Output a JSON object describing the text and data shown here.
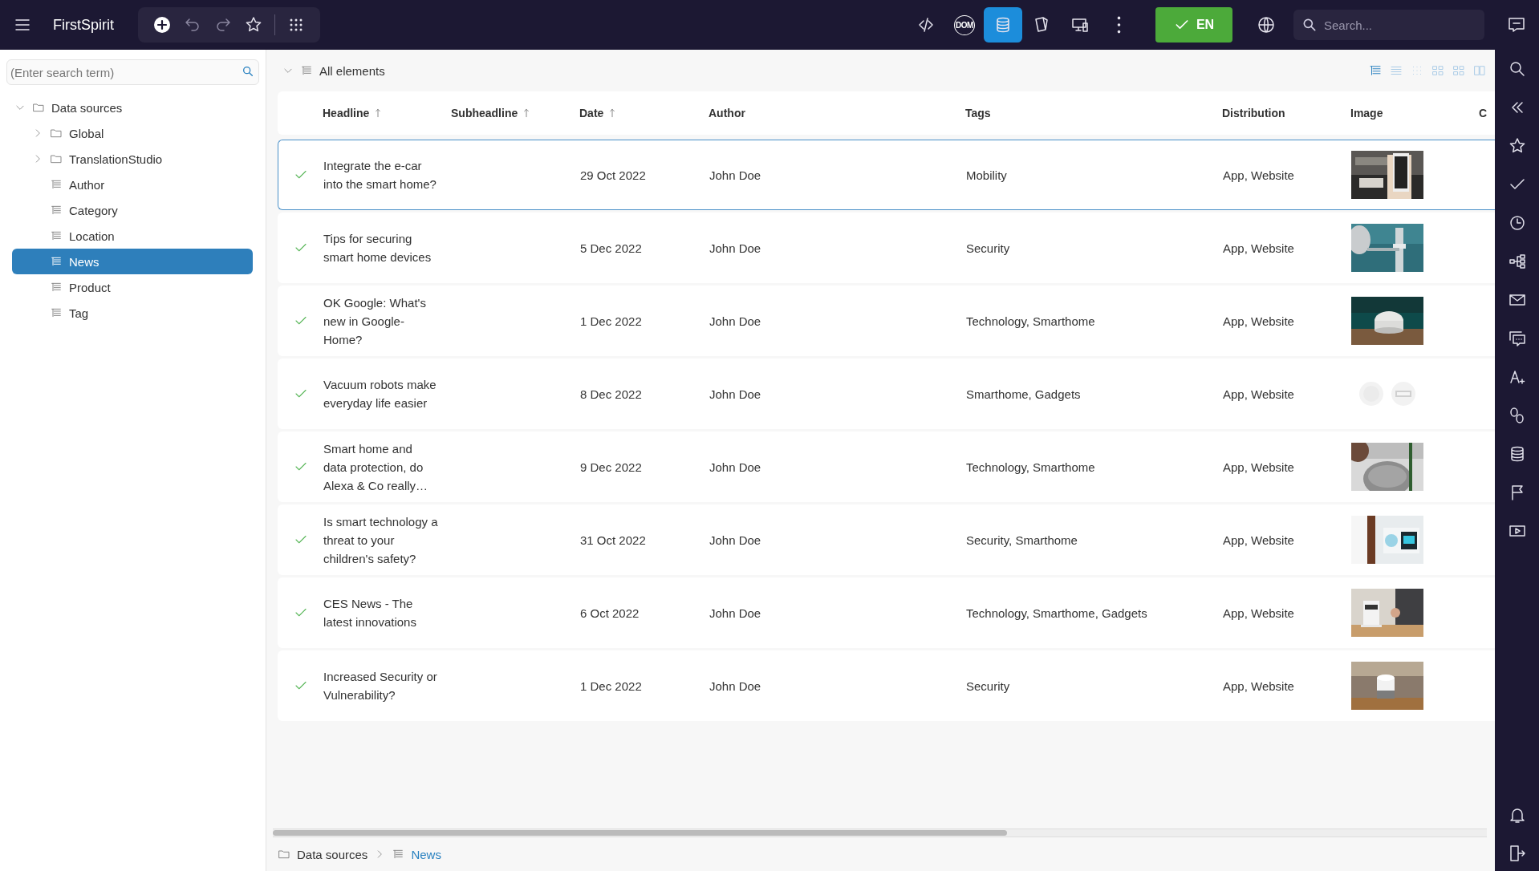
{
  "app": {
    "title": "FirstSpirit"
  },
  "toolbar_right": [
    {
      "kind": "code",
      "selected": false
    },
    {
      "kind": "dom",
      "label": "DOM",
      "selected": false
    },
    {
      "kind": "database",
      "selected": true
    },
    {
      "kind": "pages",
      "selected": false
    },
    {
      "kind": "devices",
      "selected": false
    },
    {
      "kind": "more",
      "selected": false
    }
  ],
  "language_button": {
    "label": "EN"
  },
  "search": {
    "placeholder": "Search..."
  },
  "tree_search": {
    "placeholder": "(Enter search term)"
  },
  "tree": [
    {
      "label": "Data sources",
      "kind": "folder",
      "expanded": true,
      "selected": false,
      "children": [
        {
          "label": "Global",
          "kind": "folder",
          "expanded": false,
          "selected": false
        },
        {
          "label": "TranslationStudio",
          "kind": "folder",
          "expanded": false,
          "selected": false
        },
        {
          "label": "Author",
          "kind": "table",
          "selected": false
        },
        {
          "label": "Category",
          "kind": "table",
          "selected": false
        },
        {
          "label": "Location",
          "kind": "table",
          "selected": false
        },
        {
          "label": "News",
          "kind": "table",
          "selected": true
        },
        {
          "label": "Product",
          "kind": "table",
          "selected": false
        },
        {
          "label": "Tag",
          "kind": "table",
          "selected": false
        }
      ]
    }
  ],
  "list_header": {
    "label": "All elements",
    "expanded": true
  },
  "view_modes": [
    {
      "selected": true
    },
    {
      "selected": false
    },
    {
      "selected": false
    },
    {
      "selected": false
    },
    {
      "selected": false
    },
    {
      "selected": false
    }
  ],
  "table": {
    "columns": [
      {
        "label": "Headline",
        "sorted": true
      },
      {
        "label": "Subheadline",
        "sorted": true
      },
      {
        "label": "Date",
        "sorted": true
      },
      {
        "label": "Author",
        "sorted": false
      },
      {
        "label": "Tags",
        "sorted": false
      },
      {
        "label": "Distribution",
        "sorted": false
      },
      {
        "label": "Image",
        "sorted": false
      },
      {
        "label": "C",
        "sorted": false
      }
    ],
    "rows": [
      {
        "released": true,
        "selected": true,
        "headline": "Integrate the e-car into the smart home?",
        "date": "29 Oct 2022",
        "author": "John Doe",
        "tags": "Mobility",
        "distribution": "App, Website"
      },
      {
        "released": true,
        "selected": false,
        "headline": "Tips for securing smart home devices",
        "date": "5 Dec 2022",
        "author": "John Doe",
        "tags": "Security",
        "distribution": "App, Website"
      },
      {
        "released": true,
        "selected": false,
        "headline": "OK Google: What's new in Google-Home?",
        "date": "1 Dec 2022",
        "author": "John Doe",
        "tags": "Technology, Smarthome",
        "distribution": "App, Website"
      },
      {
        "released": true,
        "selected": false,
        "headline": "Vacuum robots make everyday life easier",
        "date": "8 Dec 2022",
        "author": "John Doe",
        "tags": "Smarthome, Gadgets",
        "distribution": "App, Website"
      },
      {
        "released": true,
        "selected": false,
        "headline": "Smart home and data protection, do Alexa & Co really…",
        "date": "9 Dec 2022",
        "author": "John Doe",
        "tags": "Technology, Smarthome",
        "distribution": "App, Website"
      },
      {
        "released": true,
        "selected": false,
        "headline": "Is smart technology a threat to your children's safety?",
        "date": "31 Oct 2022",
        "author": "John Doe",
        "tags": "Security, Smarthome",
        "distribution": "App, Website"
      },
      {
        "released": true,
        "selected": false,
        "headline": "CES News - The latest innovations",
        "date": "6 Oct 2022",
        "author": "John Doe",
        "tags": "Technology, Smarthome, Gadgets",
        "distribution": "App, Website"
      },
      {
        "released": true,
        "selected": false,
        "headline": "Increased Security or Vulnerability?",
        "date": "1 Dec 2022",
        "author": "John Doe",
        "tags": "Security",
        "distribution": "App, Website"
      }
    ]
  },
  "breadcrumb": [
    {
      "label": "Data sources",
      "kind": "folder",
      "current": false
    },
    {
      "label": "News",
      "kind": "table",
      "current": true
    }
  ]
}
